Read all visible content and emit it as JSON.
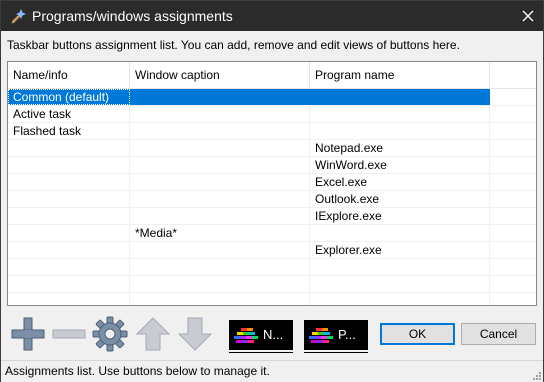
{
  "window": {
    "title": "Programs/windows assignments",
    "app_icon": "wand-icon",
    "close_icon": "close-icon"
  },
  "instructions": "Taskbar buttons assignment list. You can add, remove and edit views of buttons here.",
  "list": {
    "columns": [
      "Name/info",
      "Window caption",
      "Program name"
    ],
    "rows": [
      {
        "name": "Common (default)",
        "caption": "",
        "program": "",
        "selected": true
      },
      {
        "name": "Active task",
        "caption": "",
        "program": ""
      },
      {
        "name": "Flashed task",
        "caption": "",
        "program": ""
      },
      {
        "name": "",
        "caption": "",
        "program": "Notepad.exe"
      },
      {
        "name": "",
        "caption": "",
        "program": "WinWord.exe"
      },
      {
        "name": "",
        "caption": "",
        "program": "Excel.exe"
      },
      {
        "name": "",
        "caption": "",
        "program": "Outlook.exe"
      },
      {
        "name": "",
        "caption": "",
        "program": "IExplore.exe"
      },
      {
        "name": "",
        "caption": "*Media*",
        "program": ""
      },
      {
        "name": "",
        "caption": "",
        "program": "Explorer.exe"
      },
      {
        "name": "",
        "caption": "",
        "program": ""
      },
      {
        "name": "",
        "caption": "",
        "program": ""
      },
      {
        "name": "",
        "caption": "",
        "program": ""
      }
    ]
  },
  "toolbar": {
    "add_icon": "plus-icon",
    "remove_icon": "minus-icon",
    "settings_icon": "gear-icon",
    "move_up_icon": "arrow-up-icon",
    "move_down_icon": "arrow-down-icon",
    "normal_view_label": "N...",
    "pressed_view_label": "P..."
  },
  "buttons": {
    "ok": "OK",
    "cancel": "Cancel"
  },
  "status": "Assignments list. Use buttons below to manage it.",
  "colors": {
    "titlebar": "#2b2b2b",
    "selection": "#0078d7",
    "toolbar_icon": "#7a8ea6"
  }
}
